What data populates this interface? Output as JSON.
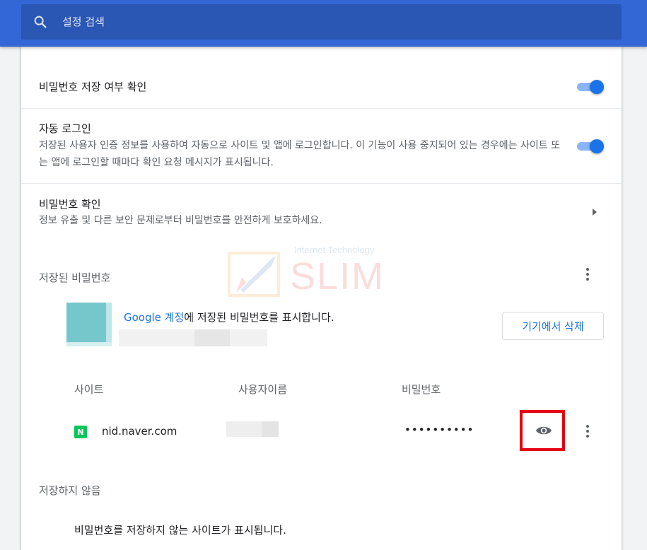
{
  "search": {
    "placeholder": "설정 검색",
    "icon": "search-icon"
  },
  "settings": {
    "offer_to_save": {
      "title": "비밀번호 저장 여부 확인",
      "enabled": true
    },
    "auto_signin": {
      "title": "자동 로그인",
      "description": "저장된 사용자 인증 정보를 사용하여 자동으로 사이트 및 앱에 로그인합니다. 이 기능이 사용 중지되어 있는 경우에는 사이트 또는 앱에 로그인할 때마다 확인 요청 메시지가 표시됩니다.",
      "enabled": true
    },
    "check_passwords": {
      "title": "비밀번호 확인",
      "description": "정보 유출 및 다른 보안 문제로부터 비밀번호를 안전하게 보호하세요."
    }
  },
  "saved_passwords": {
    "title": "저장된 비밀번호",
    "google_account_link": "Google 계정",
    "google_account_text": "에 저장된 비밀번호를 표시합니다.",
    "delete_button": "기기에서 삭제",
    "columns": [
      "사이트",
      "사용자이름",
      "비밀번호"
    ],
    "entries": [
      {
        "site": "nid.naver.com",
        "site_icon_letter": "N",
        "password_masked": "••••••••••"
      }
    ]
  },
  "never_saved": {
    "title": "저장하지 않음",
    "empty_message": "비밀번호를 저장하지 않는 사이트가 표시됩니다."
  },
  "watermark": {
    "small": "Internet Technology",
    "big": "SLIM"
  },
  "colors": {
    "topbar": "#3367d6",
    "accent": "#1a73e8",
    "highlight_box": "#e60012",
    "naver_green": "#03c75a"
  }
}
